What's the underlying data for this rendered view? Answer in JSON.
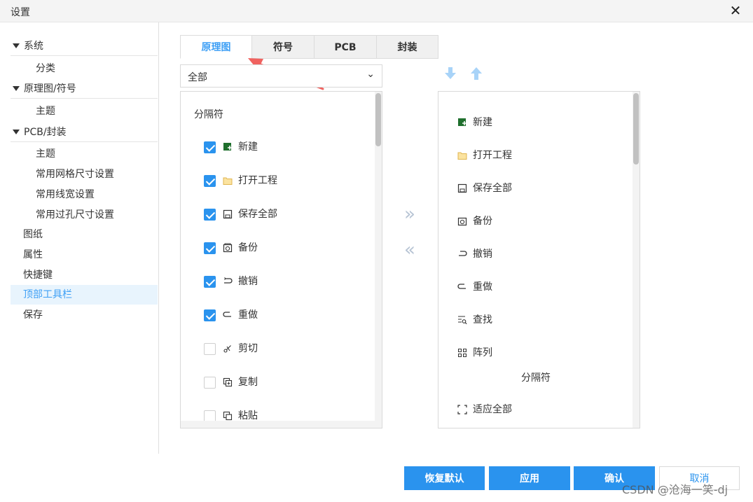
{
  "window": {
    "title": "设置",
    "close_symbol": "✕"
  },
  "sidebar": {
    "items": [
      {
        "label": "系统",
        "kind": "group"
      },
      {
        "label": "分类",
        "kind": "sub"
      },
      {
        "label": "原理图/符号",
        "kind": "group"
      },
      {
        "label": "主题",
        "kind": "sub"
      },
      {
        "label": "PCB/封装",
        "kind": "group"
      },
      {
        "label": "主题",
        "kind": "sub"
      },
      {
        "label": "常用网格尺寸设置",
        "kind": "sub"
      },
      {
        "label": "常用线宽设置",
        "kind": "sub"
      },
      {
        "label": "常用过孔尺寸设置",
        "kind": "sub"
      },
      {
        "label": "图纸",
        "kind": "plain"
      },
      {
        "label": "属性",
        "kind": "plain"
      },
      {
        "label": "快捷键",
        "kind": "plain"
      },
      {
        "label": "顶部工具栏",
        "kind": "plain",
        "active": true
      },
      {
        "label": "保存",
        "kind": "plain"
      }
    ]
  },
  "tabs": [
    {
      "label": "原理图",
      "active": true
    },
    {
      "label": "符号"
    },
    {
      "label": "PCB"
    },
    {
      "label": "封装"
    }
  ],
  "filter": {
    "value": "全部",
    "chevron": "⌄"
  },
  "available": {
    "header": "分隔符",
    "items": [
      {
        "label": "新建",
        "icon": "new-file-icon",
        "checked": true
      },
      {
        "label": "打开工程",
        "icon": "folder-icon",
        "checked": true
      },
      {
        "label": "保存全部",
        "icon": "save-icon",
        "checked": true
      },
      {
        "label": "备份",
        "icon": "backup-icon",
        "checked": true
      },
      {
        "label": "撤销",
        "icon": "undo-icon",
        "checked": true
      },
      {
        "label": "重做",
        "icon": "redo-icon",
        "checked": true
      },
      {
        "label": "剪切",
        "icon": "scissors-icon",
        "checked": false
      },
      {
        "label": "复制",
        "icon": "copy-icon",
        "checked": false
      },
      {
        "label": "粘贴",
        "icon": "paste-icon",
        "checked": false
      }
    ]
  },
  "transfer": {
    "add": "»",
    "remove": "«"
  },
  "selected": {
    "items": [
      {
        "label": "新建",
        "icon": "new-file-icon"
      },
      {
        "label": "打开工程",
        "icon": "folder-icon"
      },
      {
        "label": "保存全部",
        "icon": "save-icon"
      },
      {
        "label": "备份",
        "icon": "backup-icon"
      },
      {
        "label": "撤销",
        "icon": "undo-icon"
      },
      {
        "label": "重做",
        "icon": "redo-icon"
      },
      {
        "label": "查找",
        "icon": "find-icon"
      },
      {
        "label": "阵列",
        "icon": "array-icon"
      },
      {
        "label": "分隔符",
        "icon": ""
      },
      {
        "label": "适应全部",
        "icon": "fit-all-icon"
      }
    ]
  },
  "footer": {
    "restore_default": "恢复默认",
    "apply": "应用",
    "confirm": "确认",
    "cancel": "取消"
  },
  "watermark": "CSDN @沧海一笑-dj",
  "colors": {
    "accent": "#2a93ee",
    "annotation_arrow": "#f0625f",
    "active_bg": "#e8f4fd"
  }
}
